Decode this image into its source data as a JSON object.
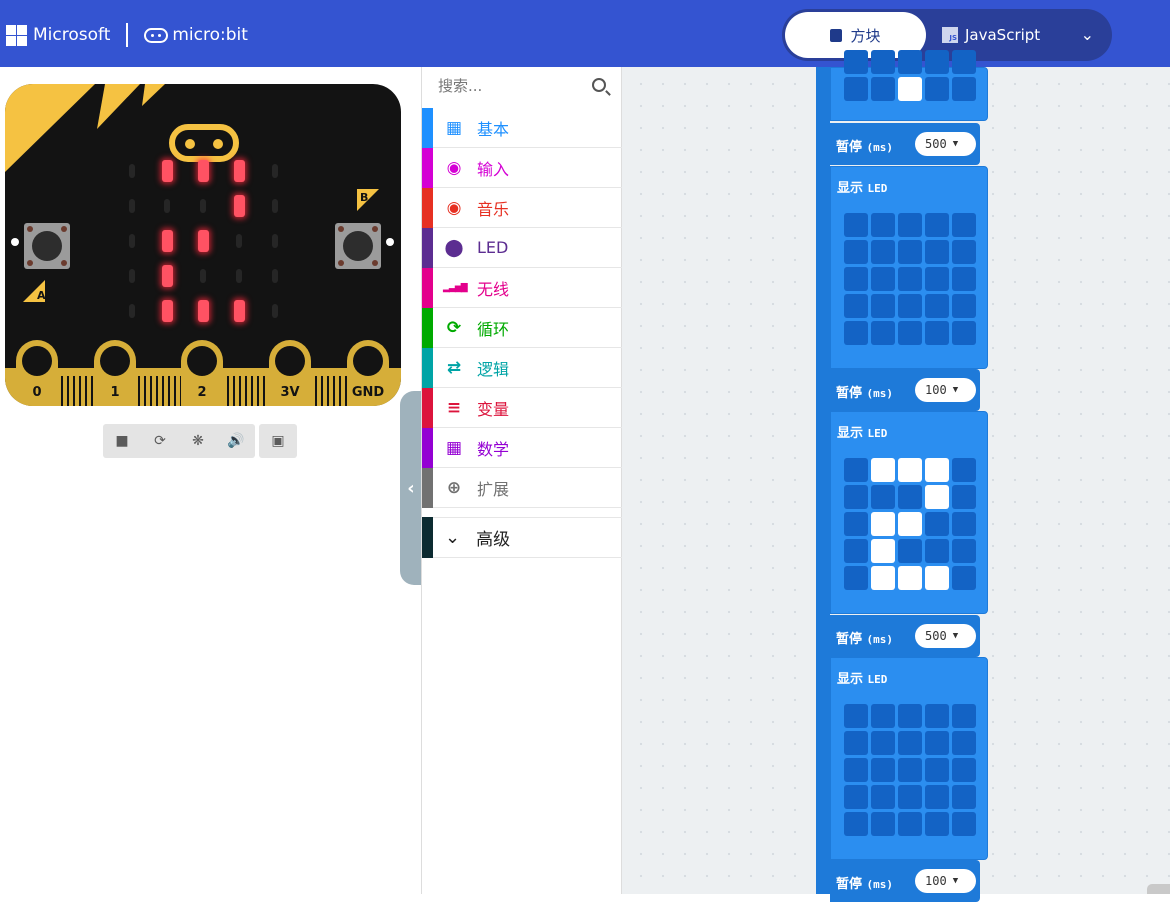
{
  "header": {
    "brand": "Microsoft",
    "product": "micro:bit",
    "editor_toggle": {
      "blocks_label": "方块",
      "javascript_label": "JavaScript",
      "js_badge": "JS"
    }
  },
  "simulator": {
    "led_matrix": [
      [
        0,
        1,
        1,
        1,
        0
      ],
      [
        0,
        0,
        0,
        1,
        0
      ],
      [
        0,
        1,
        1,
        0,
        0
      ],
      [
        0,
        1,
        0,
        0,
        0
      ],
      [
        0,
        1,
        1,
        1,
        0
      ]
    ],
    "button_a": "A",
    "button_b": "B",
    "pins": [
      "0",
      "1",
      "2",
      "3V",
      "GND"
    ],
    "controls": [
      "stop",
      "restart",
      "debug",
      "mute",
      "fullscreen"
    ]
  },
  "toolbox": {
    "search_placeholder": "搜索...",
    "categories": [
      {
        "label": "基本",
        "color": "#1e90ff",
        "icon": "grid-icon"
      },
      {
        "label": "输入",
        "color": "#d400d4",
        "icon": "input-circle-icon"
      },
      {
        "label": "音乐",
        "color": "#e63022",
        "icon": "headphones-icon"
      },
      {
        "label": "LED",
        "color": "#5c2d91",
        "icon": "toggle-icon"
      },
      {
        "label": "无线",
        "color": "#e3008c",
        "icon": "signal-bars-icon"
      },
      {
        "label": "循环",
        "color": "#00aa00",
        "icon": "loop-arrow-icon"
      },
      {
        "label": "逻辑",
        "color": "#00a4a6",
        "icon": "shuffle-icon"
      },
      {
        "label": "变量",
        "color": "#dc143c",
        "icon": "lines-icon"
      },
      {
        "label": "数学",
        "color": "#9400d3",
        "icon": "calculator-icon"
      },
      {
        "label": "扩展",
        "color": "#717171",
        "icon": "plus-circle-icon"
      }
    ],
    "advanced_label": "高级"
  },
  "workspace": {
    "blocks": [
      {
        "type": "pause",
        "label": "暂停",
        "unit": "(ms)",
        "value": "500"
      },
      {
        "type": "show_leds",
        "label": "显示",
        "suffix": "LED",
        "leds": [
          [
            0,
            0,
            0,
            0,
            0
          ],
          [
            0,
            0,
            0,
            0,
            0
          ],
          [
            0,
            0,
            0,
            0,
            0
          ],
          [
            0,
            0,
            0,
            0,
            0
          ],
          [
            0,
            0,
            0,
            0,
            0
          ]
        ]
      },
      {
        "type": "pause",
        "label": "暂停",
        "unit": "(ms)",
        "value": "100"
      },
      {
        "type": "show_leds",
        "label": "显示",
        "suffix": "LED",
        "leds": [
          [
            0,
            1,
            1,
            1,
            0
          ],
          [
            0,
            0,
            0,
            1,
            0
          ],
          [
            0,
            1,
            1,
            0,
            0
          ],
          [
            0,
            1,
            0,
            0,
            0
          ],
          [
            0,
            1,
            1,
            1,
            0
          ]
        ]
      },
      {
        "type": "pause",
        "label": "暂停",
        "unit": "(ms)",
        "value": "500"
      },
      {
        "type": "show_leds",
        "label": "显示",
        "suffix": "LED",
        "leds": [
          [
            0,
            0,
            0,
            0,
            0
          ],
          [
            0,
            0,
            0,
            0,
            0
          ],
          [
            0,
            0,
            0,
            0,
            0
          ],
          [
            0,
            0,
            0,
            0,
            0
          ],
          [
            0,
            0,
            0,
            0,
            0
          ]
        ]
      },
      {
        "type": "pause",
        "label": "暂停",
        "unit": "(ms)",
        "value": "100"
      }
    ],
    "top_partial_leds": [
      0,
      0,
      1,
      0,
      0
    ]
  }
}
